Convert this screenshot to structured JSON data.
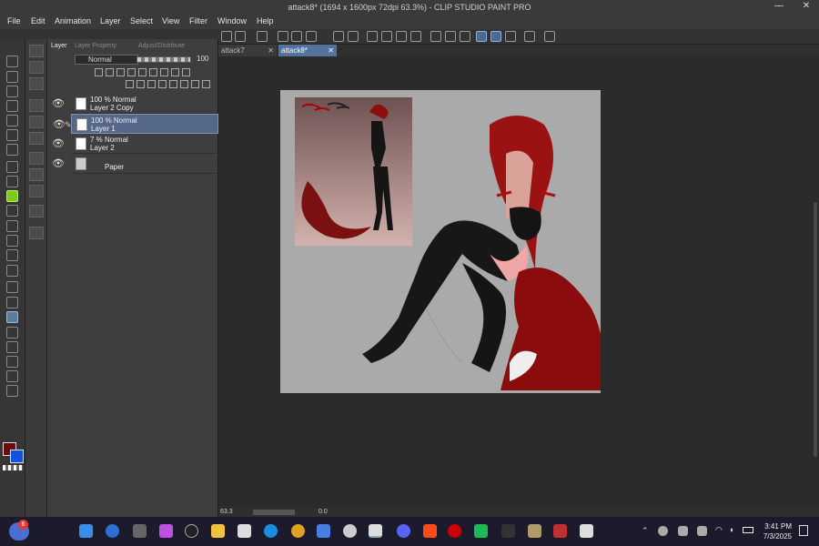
{
  "window": {
    "title": "attack8* (1694 x 1600px 72dpi 63.3%)  - CLIP STUDIO PAINT PRO",
    "minimize": "—",
    "close": "✕"
  },
  "menu": [
    "File",
    "Edit",
    "Animation",
    "Layer",
    "Select",
    "View",
    "Filter",
    "Window",
    "Help"
  ],
  "panel": {
    "tabs": [
      "Layer",
      "Layer Property",
      "Adjust/Distribute"
    ],
    "blend_mode": "Normal",
    "opacity": "100"
  },
  "layers": [
    {
      "line1": "100 % Normal",
      "line2": "Layer 2 Copy",
      "selected": false,
      "visible": true
    },
    {
      "line1": "100 % Normal",
      "line2": "Layer 1",
      "selected": true,
      "visible": true
    },
    {
      "line1": "7 % Normal",
      "line2": "Layer 2",
      "selected": false,
      "visible": true
    },
    {
      "line1": "",
      "line2": "Paper",
      "selected": false,
      "visible": true
    }
  ],
  "documents": [
    {
      "name": "attack7",
      "active": false
    },
    {
      "name": "attack8*",
      "active": true
    }
  ],
  "status": {
    "zoom": "63.3",
    "angle": "0.0"
  },
  "colors": {
    "main": "#6b0b0b",
    "sub": "#1252e0",
    "accent": "#53739c",
    "active_tool": "#7fc91e"
  },
  "taskbar": {
    "notification_badge": "6",
    "time": "3:41 PM",
    "date": "7/3/2025"
  },
  "icons": [
    "eye-icon",
    "pen-icon",
    "lock-icon",
    "trash-icon",
    "folder-icon",
    "undo-icon",
    "redo-icon",
    "brush-icon",
    "eraser-icon",
    "fill-icon",
    "text-icon",
    "wifi-icon",
    "volume-icon",
    "battery-icon"
  ]
}
